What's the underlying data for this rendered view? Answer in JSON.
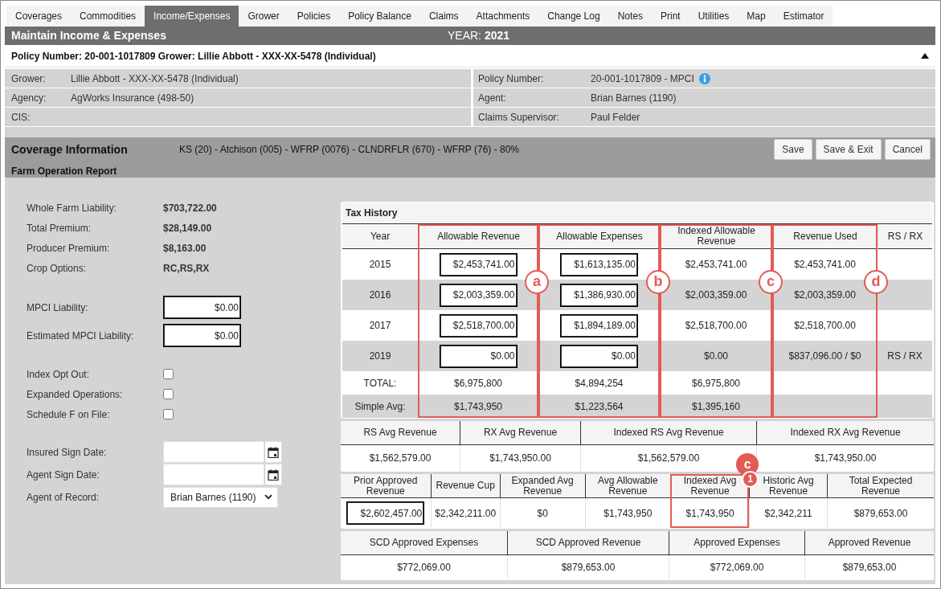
{
  "tabs": [
    {
      "label": "Coverages",
      "selected": false
    },
    {
      "label": "Commodities",
      "selected": false
    },
    {
      "label": "Income/Expenses",
      "selected": true
    },
    {
      "label": "Grower",
      "selected": false
    },
    {
      "label": "Policies",
      "selected": false
    },
    {
      "label": "Policy Balance",
      "selected": false
    },
    {
      "label": "Claims",
      "selected": false
    },
    {
      "label": "Attachments",
      "selected": false
    },
    {
      "label": "Change Log",
      "selected": false
    },
    {
      "label": "Notes",
      "selected": false
    },
    {
      "label": "Print",
      "selected": false
    },
    {
      "label": "Utilities",
      "selected": false
    },
    {
      "label": "Map",
      "selected": false
    },
    {
      "label": "Estimator",
      "selected": false
    }
  ],
  "header": {
    "title": "Maintain Income & Expenses",
    "year_label": "YEAR:",
    "year": "2021"
  },
  "policy_bar": {
    "title": "Policy Number: 20-001-1017809 Grower: Lillie Abbott - XXX-XX-5478 (Individual)",
    "expanded": true
  },
  "details": {
    "left": [
      {
        "label": "Grower:",
        "value": "Lillie Abbott - XXX-XX-5478 (Individual)"
      },
      {
        "label": "Agency:",
        "value": "AgWorks Insurance (498-50)"
      },
      {
        "label": "CIS:"
      }
    ],
    "right": [
      {
        "label": "Policy Number:",
        "value": "20-001-1017809 - MPCI",
        "info": true
      },
      {
        "label": "Agent:",
        "value": "Brian Barnes (1190)",
        "info": false
      },
      {
        "label": "Claims Supervisor:",
        "value": "Paul Felder",
        "info": false
      }
    ]
  },
  "coverage": {
    "title": "Coverage Information",
    "description": "KS (20) - Atchison (005) - WFRP (0076) - CLNDRFLR (670) - WFRP (76) - 80%",
    "buttons": [
      "Save",
      "Save & Exit",
      "Cancel"
    ],
    "subtitle": "Farm Operation Report"
  },
  "form": {
    "summary": [
      {
        "label": "Whole Farm Liability:",
        "value": "$703,722.00"
      },
      {
        "label": "Total Premium:",
        "value": "$28,149.00"
      },
      {
        "label": "Producer Premium:",
        "value": "$8,163.00"
      },
      {
        "label": "Crop Options:",
        "value": "RC,RS,RX"
      }
    ],
    "liabilities": [
      {
        "label": "MPCI Liability:",
        "value": "$0.00"
      },
      {
        "label": "Estimated MPCI Liability:",
        "value": "$0.00"
      }
    ],
    "options": [
      {
        "label": "Index Opt Out:",
        "checked": false
      },
      {
        "label": "Expanded Operations:",
        "checked": false
      },
      {
        "label": "Schedule F on File:",
        "checked": false
      }
    ],
    "signing": [
      {
        "kind": "date",
        "label": "Insured Sign Date:"
      },
      {
        "kind": "date",
        "label": "Agent Sign Date:"
      },
      {
        "kind": "select",
        "label": "Agent of Record:",
        "value": "Brian Barnes (1190)"
      }
    ]
  },
  "tax_history": {
    "title": "Tax History",
    "columns": [
      {
        "label": "Year",
        "kind": "text"
      },
      {
        "label": "Allowable Revenue",
        "kind": "input",
        "callout": "a"
      },
      {
        "label": "Allowable Expenses",
        "kind": "input",
        "callout": "b"
      },
      {
        "label": "Indexed Allowable Revenue",
        "kind": "text",
        "callout": "c"
      },
      {
        "label": "Revenue Used",
        "kind": "text",
        "callout": "d"
      },
      {
        "label": "RS / RX",
        "kind": "text"
      }
    ],
    "rows": [
      {
        "kind": "entry",
        "cells": [
          "2015",
          "$2,453,741.00",
          "$1,613,135.00",
          "$2,453,741.00",
          "$2,453,741.00",
          null
        ]
      },
      {
        "kind": "entry",
        "cells": [
          "2016",
          "$2,003,359.00",
          "$1,386,930.00",
          "$2,003,359.00",
          "$2,003,359.00",
          null
        ]
      },
      {
        "kind": "entry",
        "cells": [
          "2017",
          "$2,518,700.00",
          "$1,894,189.00",
          "$2,518,700.00",
          "$2,518,700.00",
          null
        ]
      },
      {
        "kind": "entry",
        "cells": [
          "2019",
          "$0.00",
          "$0.00",
          "$0.00",
          "$837,096.00 / $0",
          "RS / RX"
        ]
      },
      {
        "kind": "summary",
        "cells": [
          "TOTAL:",
          "$6,975,800",
          "$4,894,254",
          "$6,975,800",
          null,
          null
        ]
      },
      {
        "kind": "summary",
        "cells": [
          "Simple Avg:",
          "$1,743,950",
          "$1,223,564",
          "$1,395,160",
          null,
          null
        ]
      }
    ]
  },
  "averages": {
    "columns": [
      {
        "label": "RS Avg Revenue",
        "kind": "text"
      },
      {
        "label": "RX Avg Revenue",
        "kind": "text"
      },
      {
        "label": "Indexed RS Avg Revenue",
        "kind": "text"
      },
      {
        "label": "Indexed RX Avg Revenue",
        "kind": "text"
      }
    ],
    "values": [
      "$1,562,579.00",
      "$1,743,950.00",
      "$1,562,579.00",
      "$1,743,950.00"
    ]
  },
  "revenue_summary": {
    "columns": [
      {
        "label": "Prior Approved Revenue",
        "kind": "input"
      },
      {
        "label": "Revenue Cup",
        "kind": "text"
      },
      {
        "label": "Expanded Avg Revenue",
        "kind": "text"
      },
      {
        "label": "Avg Allowable Revenue",
        "kind": "text"
      },
      {
        "label": "Indexed Avg Revenue",
        "kind": "text",
        "callout": "c",
        "step": "1"
      },
      {
        "label": "Historic Avg Revenue",
        "kind": "text"
      },
      {
        "label": "Total Expected Revenue",
        "kind": "text"
      }
    ],
    "values": [
      "$2,602,457.00",
      "$2,342,211.00",
      "$0",
      "$1,743,950",
      "$1,743,950",
      "$2,342,211",
      "$879,653.00"
    ]
  },
  "approved": {
    "columns": [
      {
        "label": "SCD Approved Expenses",
        "kind": "text"
      },
      {
        "label": "SCD Approved Revenue",
        "kind": "text"
      },
      {
        "label": "Approved Expenses",
        "kind": "text"
      },
      {
        "label": "Approved Revenue",
        "kind": "text"
      }
    ],
    "values": [
      "$772,069.00",
      "$879,653.00",
      "$772,069.00",
      "$879,653.00"
    ]
  }
}
